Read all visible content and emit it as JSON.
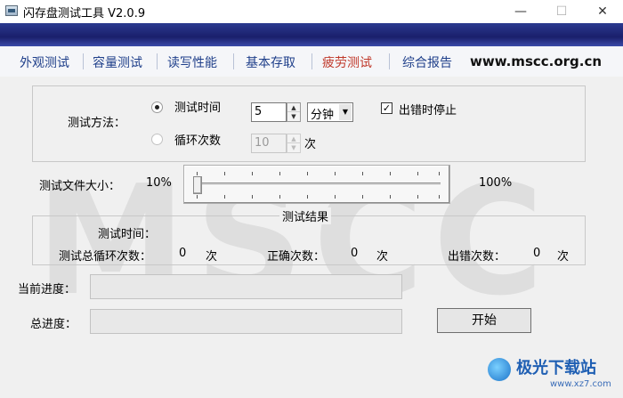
{
  "window": {
    "title": "闪存盘测试工具  V2.0.9",
    "min_glyph": "—",
    "max_glyph": "☐",
    "close_glyph": "✕"
  },
  "tabs": [
    {
      "label": "外观测试",
      "active": false
    },
    {
      "label": "容量测试",
      "active": false
    },
    {
      "label": "读写性能",
      "active": false
    },
    {
      "label": "基本存取",
      "active": false
    },
    {
      "label": "疲劳测试",
      "active": true
    },
    {
      "label": "综合报告",
      "active": false
    }
  ],
  "site": "www.mscc.org.cn",
  "watermark": "MSCC",
  "method": {
    "label": "测试方法：",
    "option_time": "测试时间",
    "option_count": "循环次数",
    "time_value": "5",
    "unit_selected": "分钟",
    "count_value": "10",
    "count_unit": "次",
    "stop_on_error_label": "出错时停止",
    "stop_on_error_checked": true
  },
  "file_size": {
    "label": "测试文件大小：",
    "min_label": "10%",
    "max_label": "100%"
  },
  "results": {
    "title": "测试结果",
    "time_label": "测试时间：",
    "total_label": "测试总循环次数：",
    "total_value": "0",
    "total_unit": "次",
    "correct_label": "正确次数：",
    "correct_value": "0",
    "correct_unit": "次",
    "error_label": "出错次数：",
    "error_value": "0",
    "error_unit": "次"
  },
  "progress": {
    "current_label": "当前进度：",
    "total_label": "总进度：",
    "current_fraction": 0,
    "total_fraction": 0
  },
  "start_button": "开始",
  "brand": {
    "text": "极光下载站",
    "sub": "www.xz7.com"
  }
}
